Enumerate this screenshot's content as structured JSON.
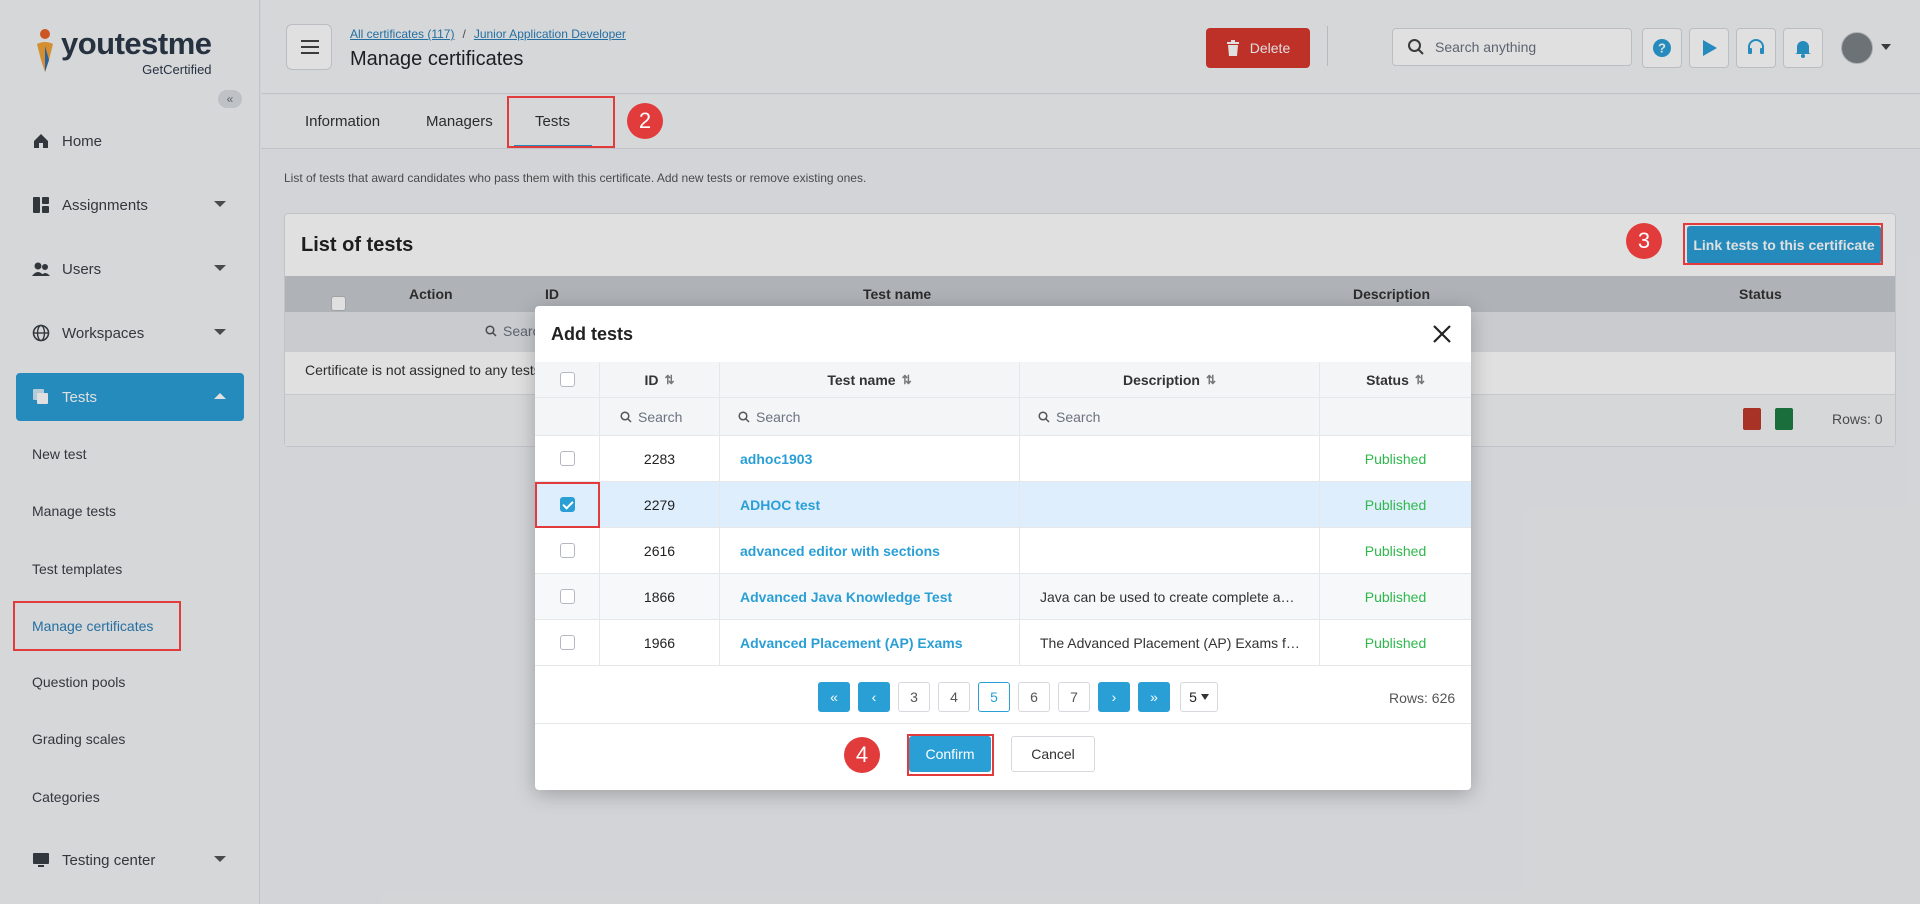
{
  "sidebar": {
    "logo_text": "youtestme",
    "logo_sub": "GetCertified",
    "items": [
      {
        "label": "Home",
        "icon": "home-icon"
      },
      {
        "label": "Assignments",
        "icon": "assignments-icon"
      },
      {
        "label": "Users",
        "icon": "users-icon"
      },
      {
        "label": "Workspaces",
        "icon": "globe-icon"
      },
      {
        "label": "Tests",
        "icon": "tests-icon"
      }
    ],
    "subitems": [
      "New test",
      "Manage tests",
      "Test templates",
      "Manage certificates",
      "Question pools",
      "Grading scales",
      "Categories"
    ],
    "testing_center": "Testing center"
  },
  "header": {
    "crumb1": "All certificates (117)",
    "crumb_sep": "/",
    "crumb2": "Junior Application Developer",
    "title": "Manage certificates",
    "delete": "Delete",
    "search_placeholder": "Search anything"
  },
  "tabs": [
    "Information",
    "Managers",
    "Tests"
  ],
  "description": "List of tests that award candidates who pass them with this certificate. Add new tests or remove existing ones.",
  "list": {
    "title": "List of tests",
    "link_button": "Link tests to this certificate",
    "columns": [
      "Action",
      "ID",
      "Test name",
      "Description",
      "Status"
    ],
    "search_placeholder": "Search",
    "empty": "Certificate is not assigned to any tests.",
    "rows_label": "Rows: 0"
  },
  "modal": {
    "title": "Add tests",
    "columns": [
      "ID",
      "Test name",
      "Description",
      "Status"
    ],
    "search_placeholder": "Search",
    "rows": [
      {
        "id": "2283",
        "name": "adhoc1903",
        "description": "",
        "status": "Published",
        "checked": false
      },
      {
        "id": "2279",
        "name": "ADHOC test",
        "description": "",
        "status": "Published",
        "checked": true
      },
      {
        "id": "2616",
        "name": "advanced editor with sections",
        "description": "",
        "status": "Published",
        "checked": false
      },
      {
        "id": "1866",
        "name": "Advanced Java Knowledge Test",
        "description": "Java can be used to create complete a…",
        "status": "Published",
        "checked": false
      },
      {
        "id": "1966",
        "name": "Advanced Placement (AP) Exams",
        "description": "The Advanced Placement (AP) Exams f…",
        "status": "Published",
        "checked": false
      }
    ],
    "pages": [
      "3",
      "4",
      "5",
      "6",
      "7"
    ],
    "current_page": "5",
    "rows_per_page": "5",
    "rows_count": "Rows: 626",
    "confirm": "Confirm",
    "cancel": "Cancel"
  },
  "annotations": {
    "step2": "2",
    "step3": "3",
    "step4": "4"
  },
  "colors": {
    "accent": "#2a9fd6",
    "danger": "#d9382f",
    "highlight": "#e23b3b",
    "published": "#2eb84b"
  }
}
